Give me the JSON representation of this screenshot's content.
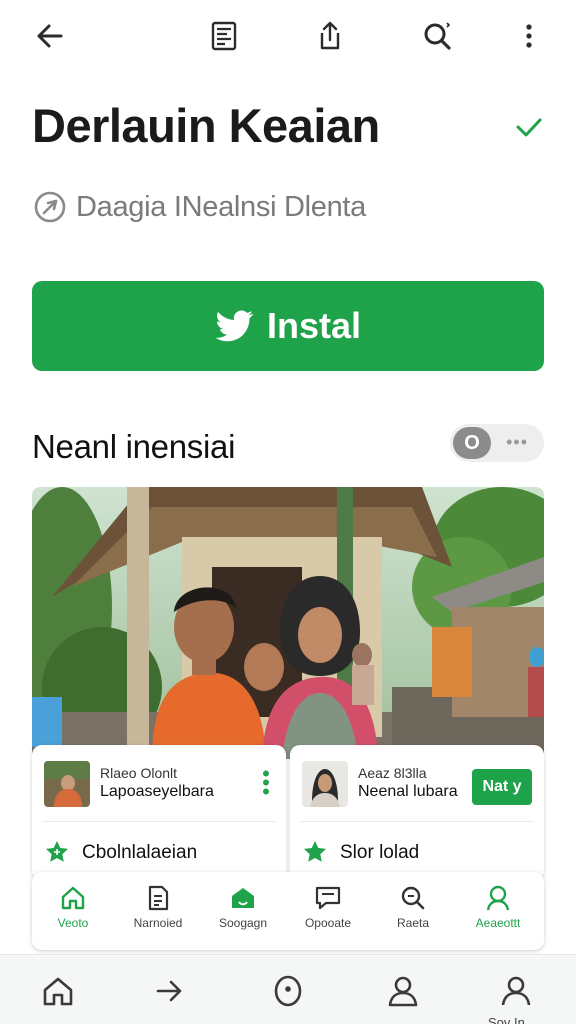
{
  "title": "Derlauin Keaian",
  "subtitle": "Daagia INealnsi Dlenta",
  "install_label": "Instal",
  "section_title": "Neanl inensiai",
  "toggle_label": "O",
  "cards": [
    {
      "small": "Rlaeo Olonlt",
      "main": "Lapoaseyelbara",
      "feature": "Cbolnlalaeian"
    },
    {
      "small": "Aeaz 8l3lla",
      "main": "Neenal lubara",
      "button": "Nat y",
      "feature": "Slor lolad"
    }
  ],
  "nav_items": [
    {
      "label": "Veoto",
      "icon": "home-icon",
      "active": true
    },
    {
      "label": "Narnoied",
      "icon": "document-icon",
      "active": false
    },
    {
      "label": "Soogagn",
      "icon": "store-icon",
      "active": false
    },
    {
      "label": "Opooate",
      "icon": "chat-icon",
      "active": false
    },
    {
      "label": "Raeta",
      "icon": "search-icon",
      "active": false
    },
    {
      "label": "Aeaeottt",
      "icon": "account-icon",
      "active": true
    }
  ],
  "bottom_label": "Sov In",
  "colors": {
    "accent": "#1fa34a",
    "text": "#1b1b1b",
    "muted": "#7a7a7a"
  }
}
